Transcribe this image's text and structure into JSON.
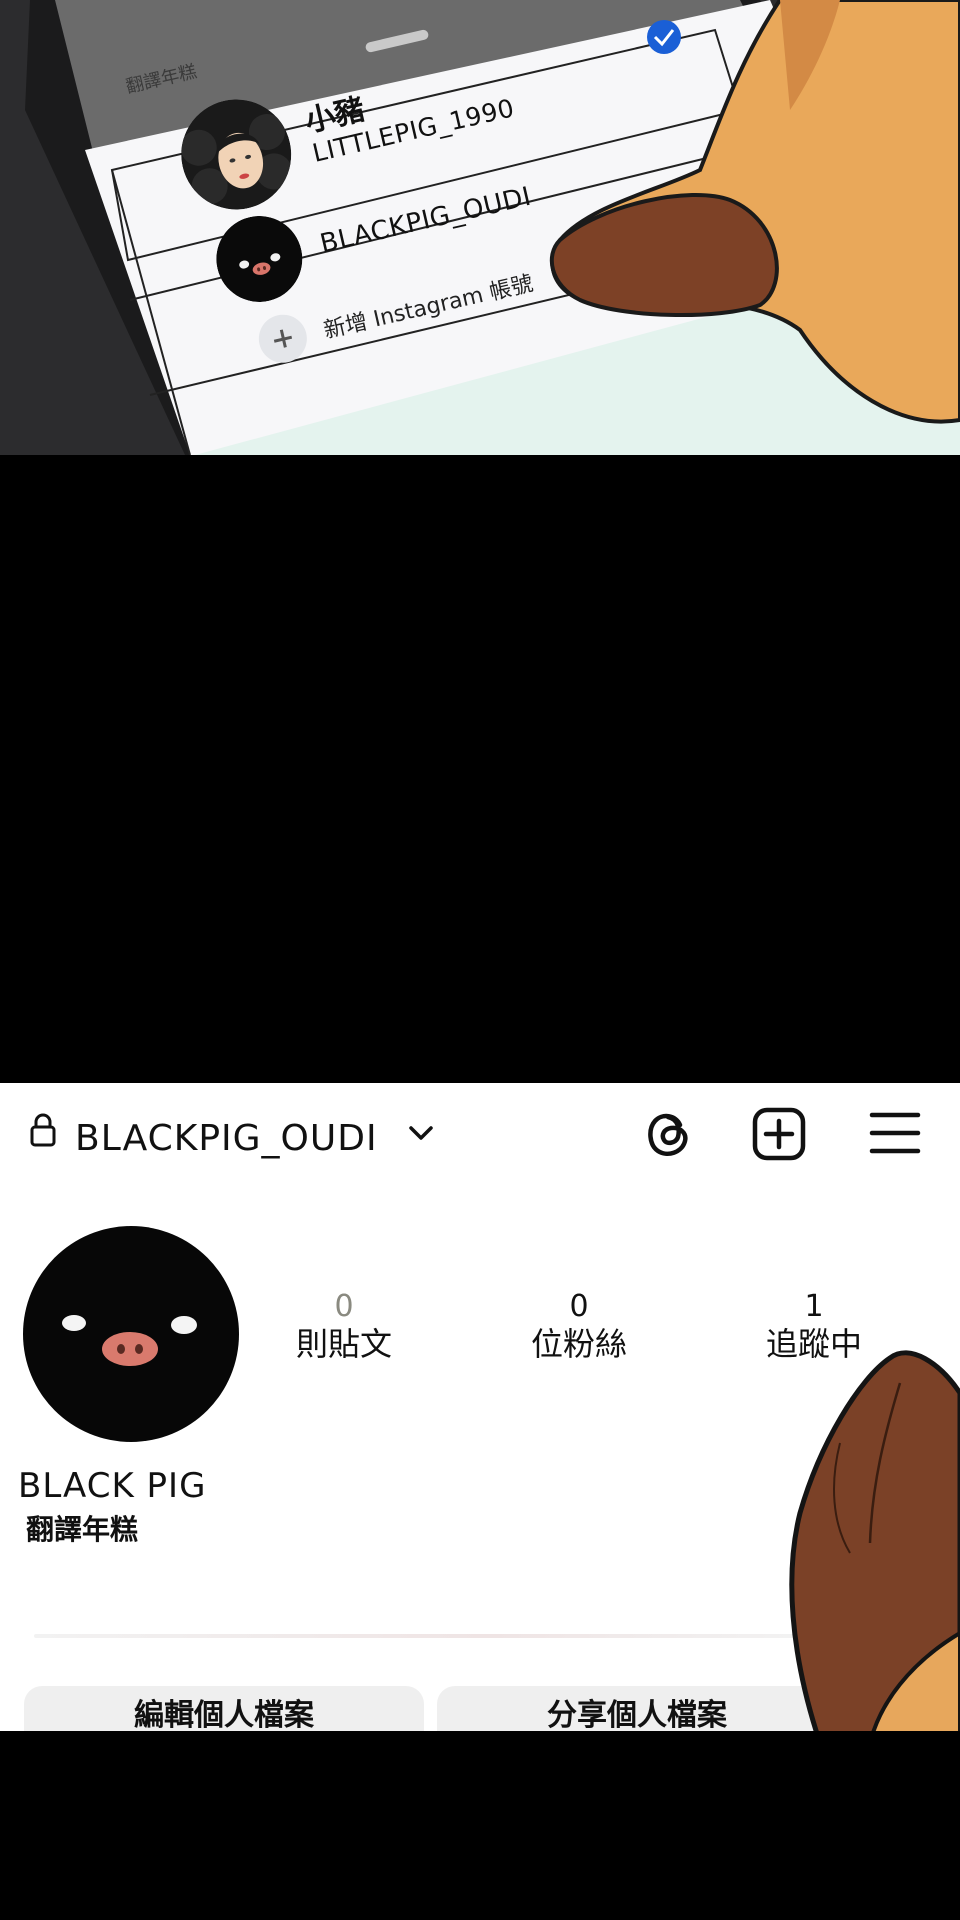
{
  "account_switcher": {
    "sheet_title": "翻譯年糕",
    "accounts": [
      {
        "name": "小豬",
        "handle": "LITTLEPIG_1990",
        "selected": true
      },
      {
        "name": "",
        "handle": "BLACKPIG_OUDI",
        "selected": false
      }
    ],
    "add_account_label": "新增 Instagram 帳號"
  },
  "profile": {
    "username": "BLACKPIG_OUDI",
    "stats": [
      {
        "value": "0",
        "label": "則貼文"
      },
      {
        "value": "0",
        "label": "位粉絲"
      },
      {
        "value": "1",
        "label": "追蹤中"
      }
    ],
    "display_name": "BLACK PIG",
    "bio": "翻譯年糕",
    "edit_button": "編輯個人檔案",
    "share_button": "分享個人檔案"
  },
  "colors": {
    "check_badge": "#1a5fd6",
    "skin": "#8b4a2b",
    "screen_bg": "#ffffff",
    "panel_bg": "#000000"
  }
}
